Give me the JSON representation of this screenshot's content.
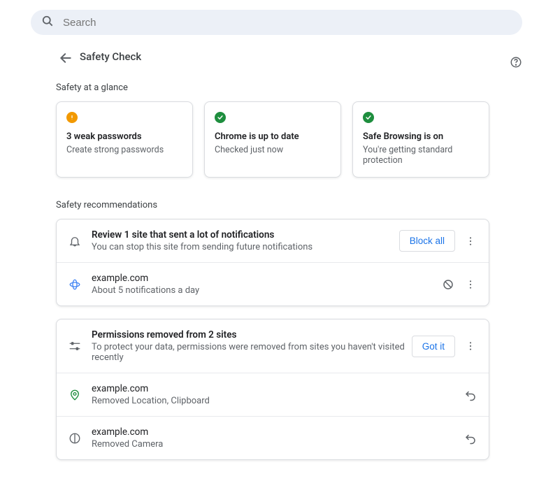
{
  "search": {
    "placeholder": "Search"
  },
  "header": {
    "title": "Safety Check"
  },
  "glance": {
    "label": "Safety at a glance",
    "cards": [
      {
        "status": "warn",
        "title": "3 weak passwords",
        "sub": "Create strong passwords"
      },
      {
        "status": "ok",
        "title": "Chrome is up to date",
        "sub": "Checked just now"
      },
      {
        "status": "ok",
        "title": "Safe Browsing is on",
        "sub": "You're getting standard protection"
      }
    ]
  },
  "recs": {
    "label": "Safety recommendations",
    "notifications": {
      "title": "Review 1 site that sent a lot of notifications",
      "sub": "You can stop this site from sending future notifications",
      "action": "Block all",
      "sites": [
        {
          "domain": "example.com",
          "detail": "About 5 notifications a day"
        }
      ]
    },
    "permissions": {
      "title": "Permissions removed from 2 sites",
      "sub": "To protect your data, permissions were removed from sites you haven't visited recently",
      "action": "Got it",
      "sites": [
        {
          "domain": "example.com",
          "detail": "Removed Location, Clipboard"
        },
        {
          "domain": "example.com",
          "detail": "Removed Camera"
        }
      ]
    }
  }
}
